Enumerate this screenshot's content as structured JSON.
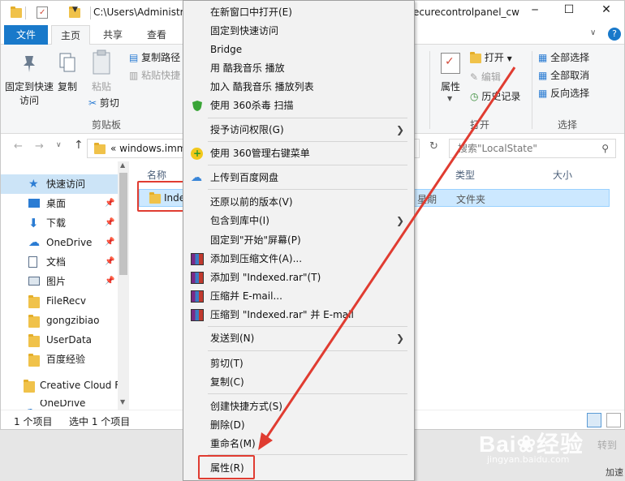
{
  "window": {
    "path": "C:\\Users\\Administra",
    "path_right": "ecurecontrolpanel_cw",
    "controls": [
      "─",
      "☐",
      "✕"
    ]
  },
  "ribbon_tabs": {
    "file": "文件",
    "home": "主页",
    "share": "共享",
    "view": "查看"
  },
  "ribbon": {
    "pin_label": "固定到快速访问",
    "copy": "复制",
    "paste": "粘贴",
    "copy_path": "复制路径",
    "paste_shortcut": "粘贴快捷",
    "cut": "剪切",
    "clipboard_group": "剪贴板",
    "properties": "属性",
    "open": "打开",
    "edit": "编辑",
    "history": "历史记录",
    "open_group": "打开",
    "select_all": "全部选择",
    "select_none": "全部取消",
    "invert": "反向选择",
    "select_group": "选择"
  },
  "nav": {
    "breadcrumb": "«  windows.imm",
    "search_placeholder": "搜索\"LocalState\""
  },
  "sidebar": {
    "items": [
      {
        "label": "快速访问",
        "icon": "star-icon",
        "color": "#2b7cd3"
      },
      {
        "label": "桌面",
        "icon": "desktop-icon",
        "color": "#2b7cd3",
        "pinned": true
      },
      {
        "label": "下载",
        "icon": "download-icon",
        "color": "#2b7cd3",
        "pinned": true
      },
      {
        "label": "OneDrive",
        "icon": "cloud-icon",
        "color": "#2b7cd3",
        "pinned": true
      },
      {
        "label": "文档",
        "icon": "document-icon",
        "color": "#5a6f8a",
        "pinned": true
      },
      {
        "label": "图片",
        "icon": "picture-icon",
        "color": "#5a6f8a",
        "pinned": true
      },
      {
        "label": "FileRecv",
        "icon": "folder-icon",
        "color": "#f0c24a"
      },
      {
        "label": "gongzibiao",
        "icon": "folder-icon",
        "color": "#f0c24a"
      },
      {
        "label": "UserData",
        "icon": "folder-icon",
        "color": "#f0c24a"
      },
      {
        "label": "百度经验",
        "icon": "folder-icon",
        "color": "#f0c24a"
      },
      {
        "label": "Creative Cloud F",
        "icon": "folder-icon",
        "color": "#f0c24a"
      },
      {
        "label": "OneDrive",
        "icon": "cloud-icon",
        "color": "#2b7cd3"
      }
    ]
  },
  "columns": {
    "name": "名称",
    "type": "类型",
    "size": "大小"
  },
  "file_row": {
    "name": "Indexed",
    "date_fragment": "星期",
    "type": "文件夹"
  },
  "status": {
    "count": "1 个项目",
    "selected": "选中 1 个项目"
  },
  "context_menu": {
    "items": [
      {
        "label": "在新窗口中打开(E)"
      },
      {
        "label": "固定到快速访问"
      },
      {
        "label": "Bridge"
      },
      {
        "label": "用 酷我音乐 播放"
      },
      {
        "label": "加入 酷我音乐 播放列表"
      },
      {
        "label": "使用 360杀毒 扫描",
        "icon": "shield-icon"
      },
      {
        "label": "授予访问权限(G)",
        "submenu": true
      },
      {
        "label": "使用 360管理右键菜单",
        "icon": "360-icon"
      },
      {
        "label": "上传到百度网盘",
        "icon": "cloud-upload-icon"
      },
      {
        "label": "还原以前的版本(V)"
      },
      {
        "label": "包含到库中(I)",
        "submenu": true
      },
      {
        "label": "固定到\"开始\"屏幕(P)"
      },
      {
        "label": "添加到压缩文件(A)...",
        "icon": "rar-icon"
      },
      {
        "label": "添加到 \"Indexed.rar\"(T)",
        "icon": "rar-icon"
      },
      {
        "label": "压缩并 E-mail...",
        "icon": "rar-icon"
      },
      {
        "label": "压缩到 \"Indexed.rar\" 并 E-mail",
        "icon": "rar-icon"
      },
      {
        "label": "发送到(N)",
        "submenu": true
      },
      {
        "label": "剪切(T)"
      },
      {
        "label": "复制(C)"
      },
      {
        "label": "创建快捷方式(S)"
      },
      {
        "label": "删除(D)"
      },
      {
        "label": "重命名(M)"
      },
      {
        "label": "属性(R)"
      }
    ]
  },
  "watermark": {
    "brand": "Bai",
    "brand_cn": "经验",
    "url": "jingyan.baidu.com",
    "side_text": "转到",
    "speed": "加速"
  },
  "accent_color": "#1979ca",
  "highlight_color": "#e03c31"
}
